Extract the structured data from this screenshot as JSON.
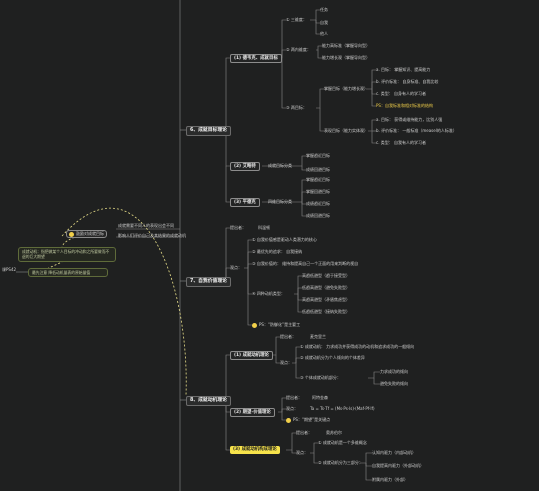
{
  "left_edge": {
    "label": "课PS42"
  },
  "summary_node": {
    "text": "鼓励对成就目标"
  },
  "top_notes": [
    "成就需要不同人的表现出会不同",
    "影响人们评价自己及其结果的成就动机"
  ],
  "left_notes": [
    {
      "text": "成就动机：指把做某个人目标的冲动和之所要做而不退的巨大期望",
      "kind": "note"
    },
    {
      "text": "最先注意   降低动机量表的原始量值",
      "kind": "note"
    }
  ],
  "sections": [
    {
      "id": "s6",
      "title": "6、成就目标理论",
      "children": [
        {
          "title": "(1) 德韦克、成就目标",
          "items": [
            {
              "label": "① 三维度：",
              "sub": [
                "任务",
                "自我",
                "他人"
              ]
            },
            {
              "label": "② 两内维度：",
              "sub": [
                "能力高标准（掌握导向型）",
                "能力增长观（掌握导向型）"
              ]
            },
            {
              "label": "③ 两目标：",
              "groups": [
                {
                  "label": "掌握目标（能力增长观）",
                  "items": [
                    "a. 目标：       掌握知识、提高能力",
                    "b. 评价标准：         自身标准、自我比较",
                    "c. 类型：        自身有人的学习者",
                    "PS：自我标准和相对标准的结构"
                  ]
                },
                {
                  "label": "表现目标（能力实体观）",
                  "items": [
                    "a. 目标：        获得或维持能力，比别人强",
                    "b. 评价标准：         一般标准（measel的人标准）",
                    "c. 类型：          自我有人的学习者"
                  ]
                }
              ]
            }
          ]
        },
        {
          "title": "(2) 艾略特",
          "items": [
            {
              "label": "成就目标分类",
              "sub": [
                "掌握趋近目标",
                "成绩回避目标"
              ]
            }
          ]
        },
        {
          "title": "(3) 平德克",
          "items": [
            {
              "label": "四维目标分类",
              "sub": [
                "掌握趋近目标",
                "掌握回避目标",
                "成绩趋近目标",
                "成绩回避目标"
              ]
            }
          ]
        }
      ]
    },
    {
      "id": "s7",
      "title": "7、自我价值理论",
      "children": [
        {
          "label": "提出者：",
          "value": "科温顿"
        },
        {
          "label": "观点：",
          "items": [
            "① 自我价值感是驱动人类潜力的核心",
            "② 最优先的追求：        自我接纳",
            "③ 自我价值的：        维持和提高自己一个正面的用来判断的视自",
            "④ 四种动机类型：",
            "PS：“防御化”是主要工"
          ],
          "types": [
            "高趋低避型（趋于接受型）",
            "低趋高避型（避免失败型）",
            "高趋高避型（矛盾焦虑型）",
            "低趋低避型（接纳失败型）"
          ]
        }
      ]
    },
    {
      "id": "s8",
      "title": "8、成就动机理论",
      "children": [
        {
          "title": "(1) 成就动机理论",
          "items": [
            {
              "label": "提出者：",
              "value": "麦克里兰"
            },
            {
              "label": "观点：",
              "items": [
                "① 成就动机：        力求成功并获得成功的动机和追求成功的一般倾向",
                "② 成就动机分为个人倾向的个体差异",
                "③ 个体成就动机部分："
              ],
              "sub": [
                "力求成功的倾向",
                "避免失败的倾向"
              ]
            }
          ]
        },
        {
          "title": "(2) 期望-价值理论",
          "items": [
            {
              "label": "提出者：",
              "value": "阿特金森"
            },
            {
              "label": "观点：",
              "value": "Ta = Ts·Tf = (Ms·Ps·Is)·(Maf·Pf·If)"
            },
            {
              "label": "PS：",
              "value": "“期望”是关键点"
            }
          ]
        },
        {
          "title": "(3) 成就动机构成理论",
          "items": [
            {
              "label": "提出者：",
              "value": "奥苏伯尔"
            },
            {
              "label": "观点：",
              "items": [
                "① 成就动机是一个多维概念",
                "② 成就动机分为三部分："
              ],
              "sub": [
                "认知内驱力（内部动机）",
                "自我提高内驱力（外部动机）",
                "附属内驱力（外部）"
              ]
            }
          ]
        }
      ]
    }
  ],
  "colors": {
    "background": "#1f2020",
    "highlight": "#f7e34b",
    "note_border": "#5f6b3a"
  }
}
